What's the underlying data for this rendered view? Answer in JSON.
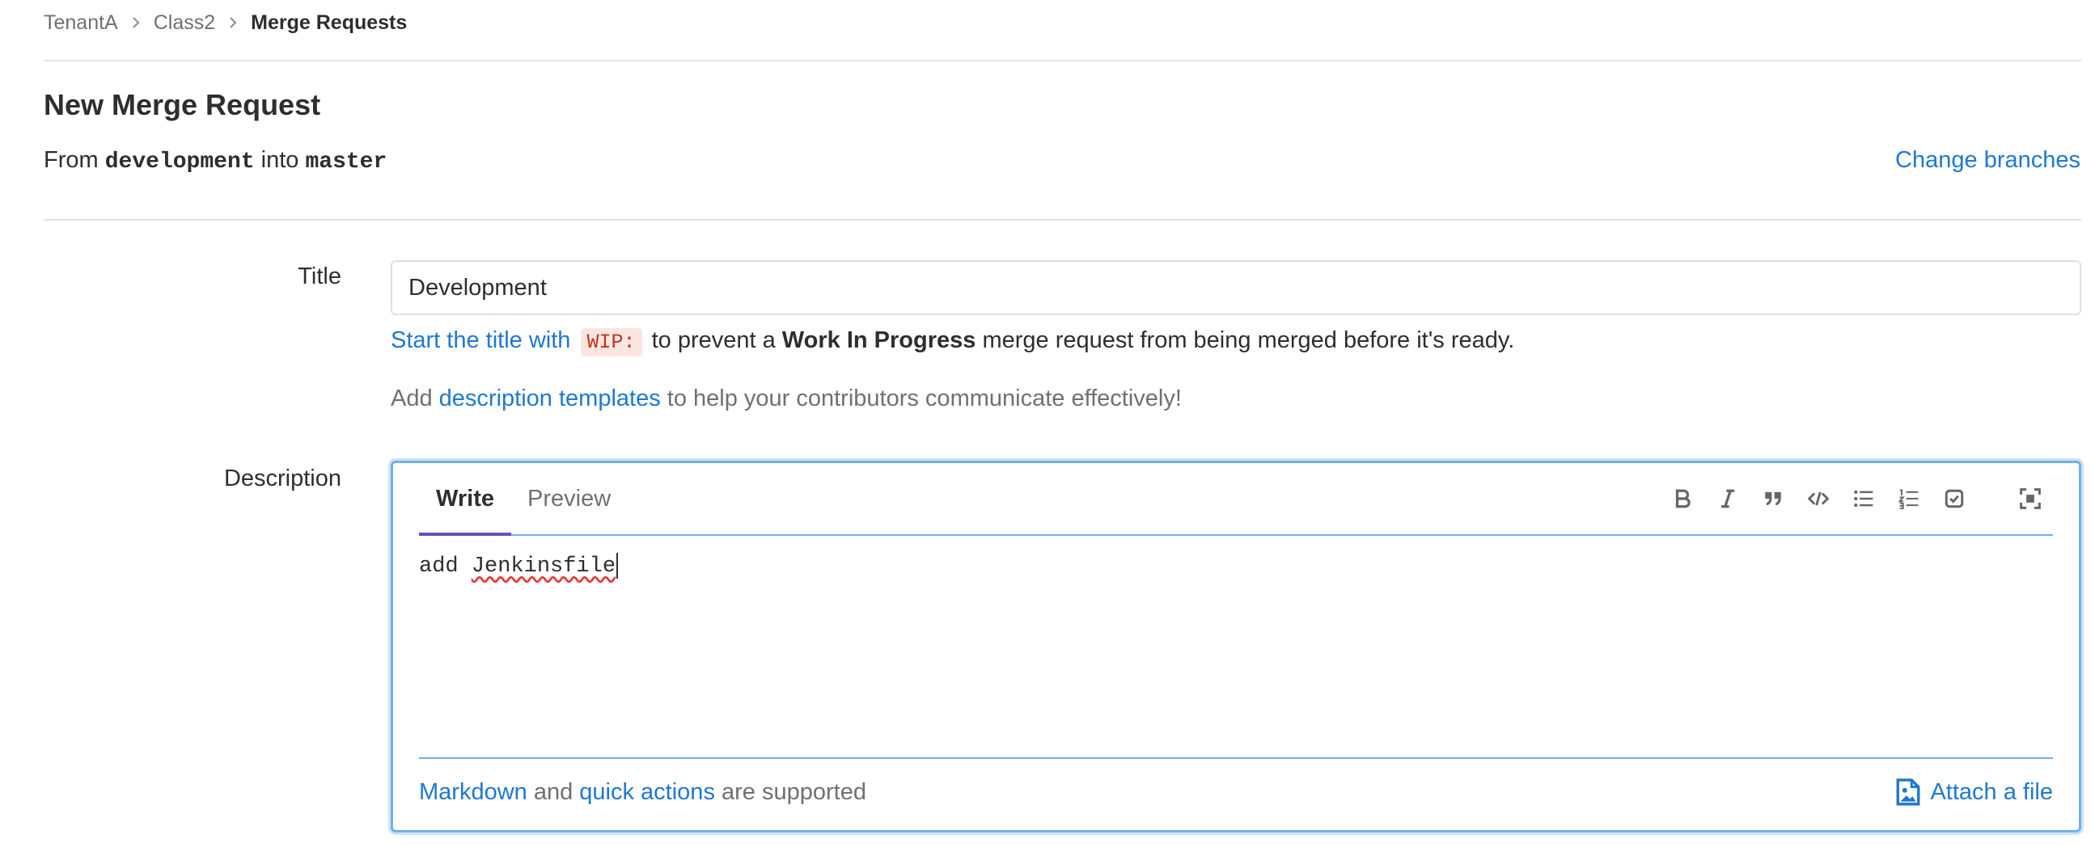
{
  "breadcrumb": {
    "items": [
      "TenantA",
      "Class2",
      "Merge Requests"
    ]
  },
  "page": {
    "title": "New Merge Request",
    "from_prefix": "From",
    "source_branch": "development",
    "into_word": "into",
    "target_branch": "master",
    "change_branches": "Change branches"
  },
  "form": {
    "title_label": "Title",
    "title_value": "Development",
    "wip_hint": {
      "link_text": "Start the title with",
      "code": "WIP:",
      "middle": "to prevent a",
      "bold": "Work In Progress",
      "end": "merge request from being merged before it's ready."
    },
    "templates_hint": {
      "prefix": "Add",
      "link_text": "description templates",
      "suffix": "to help your contributors communicate effectively!"
    },
    "description_label": "Description"
  },
  "editor": {
    "tabs": [
      "Write",
      "Preview"
    ],
    "active_tab": "Write",
    "toolbar_icons": [
      "bold-icon",
      "italic-icon",
      "quote-icon",
      "code-icon",
      "bullet-list-icon",
      "numbered-list-icon",
      "task-list-icon",
      "fullscreen-icon"
    ],
    "text_word1": "add",
    "text_word2": "Jenkinsfile",
    "footer": {
      "markdown_link": "Markdown",
      "and_word": "and",
      "quick_actions_link": "quick actions",
      "suffix": "are supported"
    },
    "attach_label": "Attach a file"
  },
  "colors": {
    "link": "#1f78d1",
    "focus_border": "#73afea",
    "active_tab_underline": "#6b4fbb",
    "text": "#2e2e2e",
    "muted": "#707070"
  }
}
